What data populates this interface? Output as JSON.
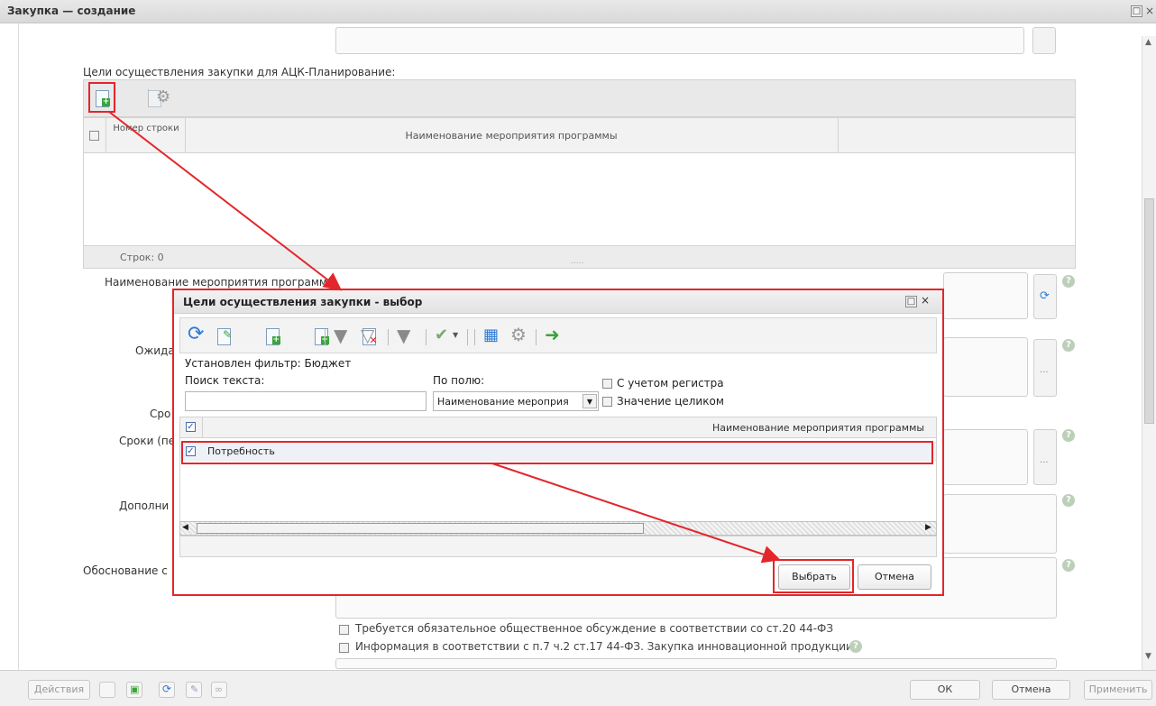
{
  "window": {
    "title": "Закупка — создание"
  },
  "goals_section": {
    "label": "Цели осуществления закупки для АЦК-Планирование:",
    "columns": [
      "Номер строки",
      "Наименование мероприятия программы"
    ],
    "row_count": "Строк: 0",
    "resize_dots": "....."
  },
  "form_labels": {
    "program_activity": "Наименование мероприятия программы",
    "expected": "Ожида",
    "terms": "Сро",
    "terms_period": "Сроки (пер",
    "additional": "Дополни",
    "justification": "Обоснование с",
    "ellipsis": "..."
  },
  "checkboxes": [
    "Требуется обязательное общественное обсуждение в соответствии со ст.20 44-ФЗ",
    "Информация в соответствии с п.7 ч.2 ст.17 44-ФЗ. Закупка инновационной продукции"
  ],
  "dialog": {
    "title": "Цели осуществления закупки - выбор",
    "filter_text": "Установлен фильтр: Бюджет",
    "search_label": "Поиск текста:",
    "search_value": "",
    "field_label": "По полю:",
    "field_value": "Наименование мероприя",
    "case_label": "С учетом регистра",
    "whole_label": "Значение целиком",
    "column_header": "Наименование мероприятия программы",
    "rows": [
      "Потребность"
    ],
    "select_button": "Выбрать",
    "cancel_button": "Отмена"
  },
  "bottom": {
    "actions": "Действия",
    "ok": "ОК",
    "cancel": "Отмена",
    "apply": "Применить"
  },
  "colors": {
    "annotation_red": "#e3262b",
    "dialog_header": "#e6e6e6",
    "help_icon": "#bcd0b8"
  },
  "icons": [
    "add-doc-icon",
    "edit-doc-icon",
    "settings-gear-icon",
    "refresh-icon",
    "filter-icon",
    "exit-icon"
  ]
}
